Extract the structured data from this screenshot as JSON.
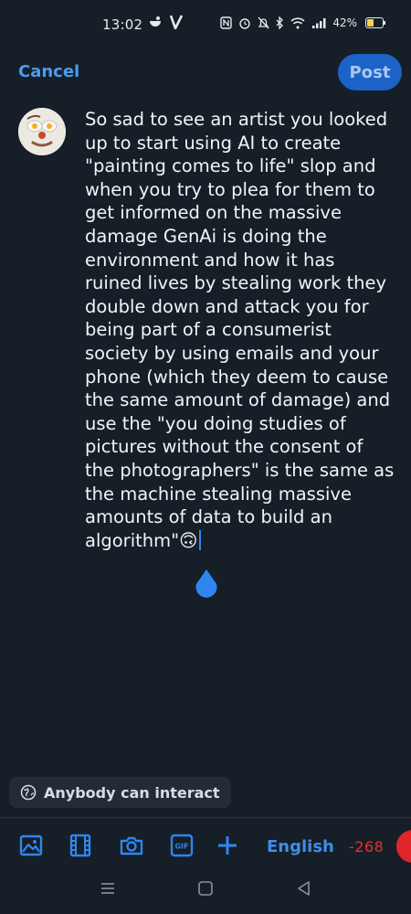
{
  "status_bar": {
    "time": "13:02",
    "battery": "42%",
    "icons": [
      "nfc-icon",
      "alarm-icon",
      "mute-icon",
      "bluetooth-icon",
      "wifi-icon",
      "signal-icon",
      "battery-icon"
    ]
  },
  "header": {
    "cancel_label": "Cancel",
    "post_label": "Post"
  },
  "compose": {
    "text": "So sad to see an artist you looked up to start using AI to create \"painting comes to life\" slop and when you try to plea for them to get informed on the massive damage GenAi is doing the environment and how it has ruined lives by stealing work they double down and attack you for being part of a consumerist society by using emails and your phone (which they deem to cause the same amount of damage) and use the \"you doing studies of pictures without the consent of the photographers\" is the same as the machine stealing massive amounts of data to build an algorithm\"🙃"
  },
  "audience": {
    "label": "Anybody can interact"
  },
  "toolbar": {
    "icons": [
      "image-icon",
      "video-icon",
      "camera-icon",
      "gif-icon",
      "plus-icon"
    ],
    "language": "English",
    "char_count": "-268"
  },
  "colors": {
    "background": "#161e27",
    "accent": "#4b9cf0",
    "post_button": "#1d63c7",
    "over_limit": "#e2312f"
  }
}
